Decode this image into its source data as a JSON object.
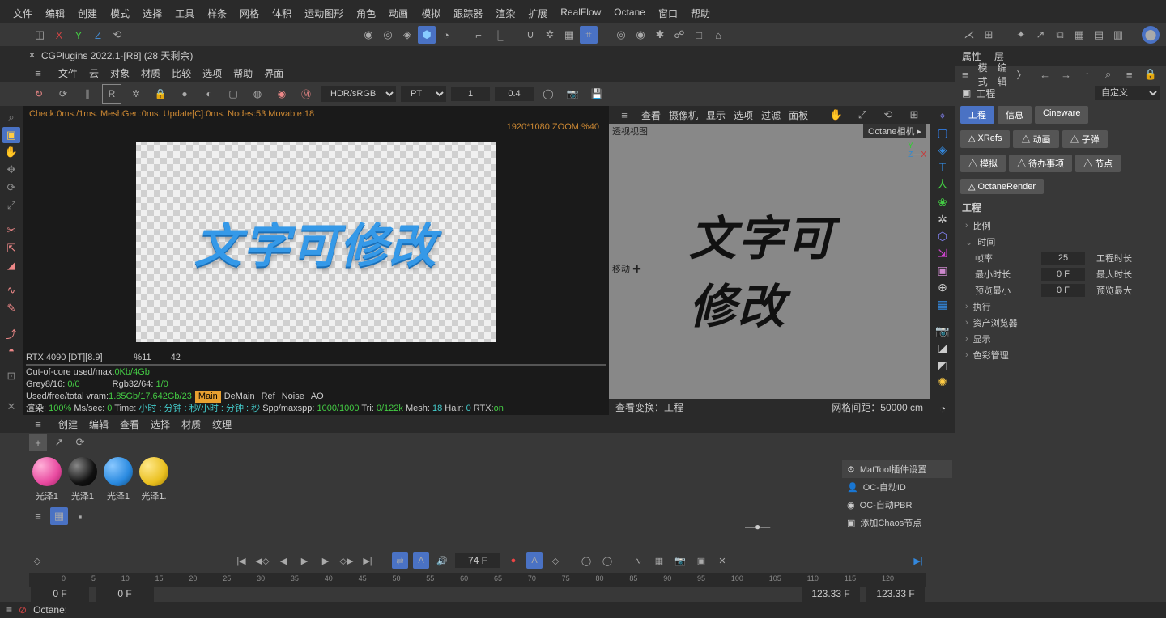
{
  "menubar": [
    "文件",
    "编辑",
    "创建",
    "模式",
    "选择",
    "工具",
    "样条",
    "网格",
    "体积",
    "运动图形",
    "角色",
    "动画",
    "模拟",
    "跟踪器",
    "渲染",
    "扩展",
    "RealFlow",
    "Octane",
    "窗口",
    "帮助"
  ],
  "axes": {
    "x": "X",
    "y": "Y",
    "z": "Z"
  },
  "title": "CGPlugins   2022.1-[R8] (28 天剩余)",
  "row4": [
    "文件",
    "云",
    "对象",
    "材质",
    "比较",
    "选项",
    "帮助",
    "界面"
  ],
  "row5": {
    "color": "HDR/sRGB",
    "space": "PT",
    "one": "1",
    "exp": "0.4"
  },
  "render": {
    "check": "Check:0ms./1ms. MeshGen:0ms. Update[C]:0ms. Nodes:53 Movable:18",
    "dim": "1920*1080 ZOOM:%40",
    "text": "文字可修改",
    "gpu": "RTX 4090 [DT][8.9]",
    "pct": "%11",
    "ms": "42",
    "ooc": "Out-of-core used/max:",
    "oocv": "0Kb/4Gb",
    "grey8": "Grey8/16: ",
    "grey8v": "0/0",
    "rgb": "Rgb32/64: ",
    "rgbv": "1/0",
    "vram": "Used/free/total vram: ",
    "vramv": "1.85Gb/17.642Gb/23",
    "tabs": [
      "Main",
      "DeMain",
      "Ref",
      "Noise",
      "AO"
    ],
    "line1": "渲染: ",
    "line1a": "100%",
    "line1b": "  Ms/sec: ",
    "line1c": "0",
    "line1d": "  Time: ",
    "line1e": "小时 : 分钟 : 秒/小时 : 分钟 : 秒",
    "line1f": "  Spp/maxspp: ",
    "line1g": "1000/1000",
    "line1h": "  Tri: ",
    "line1i": "0/122k",
    "line1j": "   Mesh: ",
    "line1k": "18",
    "line1l": "   Hair: ",
    "line1m": "0",
    "line1n": "   RTX:",
    "line1o": "on"
  },
  "vp": {
    "menus": [
      "查看",
      "摄像机",
      "显示",
      "选项",
      "过滤",
      "面板"
    ],
    "persp": "透视视图",
    "cam": "Octane相机 ▸",
    "move": "移动   ✚",
    "text": "文字可修改",
    "botL": "查看变换：工程",
    "botR": "网格间距：50000 cm"
  },
  "attrs": {
    "tabs": [
      "属性",
      "层"
    ],
    "menus": [
      "模式",
      "编辑",
      "〉"
    ],
    "proj": "工程",
    "custom": "自定义",
    "tabrow": [
      "工程",
      "信息",
      "Cineware"
    ],
    "groups": [
      [
        "△ XRefs",
        "△ 动画",
        "△ 子弹"
      ],
      [
        "△ 模拟",
        "△ 待办事项",
        "△ 节点"
      ],
      [
        "△ OctaneRender"
      ]
    ],
    "sect": "工程",
    "scale": "比例",
    "time": "时间",
    "rows": [
      {
        "a": "帧率",
        "av": "25",
        "b": "工程时长"
      },
      {
        "a": "最小时长",
        "av": "0 F",
        "b": "最大时长"
      },
      {
        "a": "预览最小",
        "av": "0 F",
        "b": "预览最大"
      }
    ],
    "exec": "执行",
    "asset": "资产浏览器",
    "disp": "显示",
    "color": "色彩管理"
  },
  "materials": {
    "menus": [
      "创建",
      "编辑",
      "查看",
      "选择",
      "材质",
      "纹理"
    ],
    "items": [
      "光泽1",
      "光泽1",
      "光泽1",
      "光泽1."
    ],
    "plugin": {
      "title": "MatTool插件设置",
      "rows": [
        "OC-自动ID",
        "OC-自动PBR",
        "添加Chaos节点"
      ]
    }
  },
  "timeline": {
    "frame": "74 F",
    "ticks": [
      "0",
      "5",
      "10",
      "15",
      "20",
      "25",
      "30",
      "35",
      "40",
      "45",
      "50",
      "55",
      "60",
      "65",
      "70",
      "75",
      "80",
      "85",
      "90",
      "95",
      "100",
      "105",
      "110",
      "115",
      "120"
    ],
    "r0a": "0 F",
    "r0b": "0 F",
    "r1a": "123.33 F",
    "r1b": "123.33 F"
  },
  "status": "Octane:"
}
